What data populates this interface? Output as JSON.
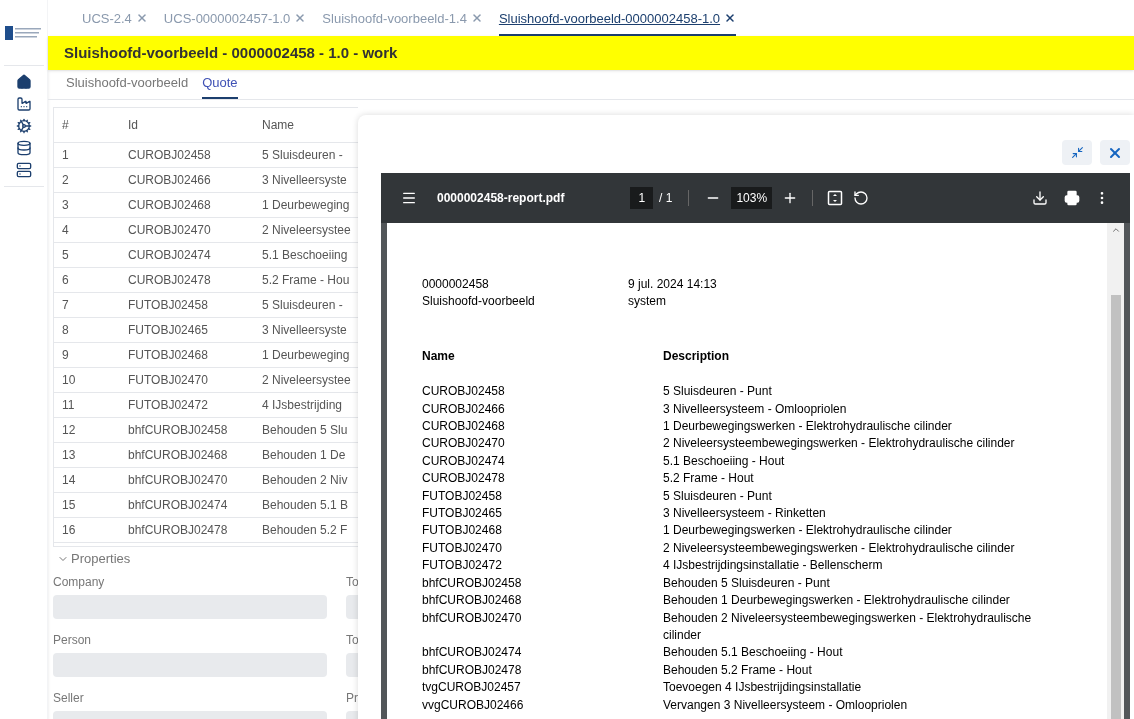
{
  "tabs": [
    {
      "label": "UCS-2.4",
      "selected": false
    },
    {
      "label": "UCS-0000002457-1.0",
      "selected": false
    },
    {
      "label": "Sluishoofd-voorbeeld-1.4",
      "selected": false
    },
    {
      "label": "Sluishoofd-voorbeeld-0000002458-1.0",
      "selected": true
    }
  ],
  "title": "Sluishoofd-voorbeeld - 0000002458 - 1.0 - work",
  "subtabs": [
    {
      "label": "Sluishoofd-voorbeeld",
      "selected": false
    },
    {
      "label": "Quote",
      "selected": true
    }
  ],
  "table": {
    "columns": [
      "#",
      "Id",
      "Name"
    ],
    "rows": [
      [
        "1",
        "CUROBJ02458",
        "5 Sluisdeuren -"
      ],
      [
        "2",
        "CUROBJ02466",
        "3 Nivelleersyste"
      ],
      [
        "3",
        "CUROBJ02468",
        "1 Deurbeweging"
      ],
      [
        "4",
        "CUROBJ02470",
        "2 Niveleersystee"
      ],
      [
        "5",
        "CUROBJ02474",
        "5.1 Beschoeiing"
      ],
      [
        "6",
        "CUROBJ02478",
        "5.2 Frame - Hou"
      ],
      [
        "7",
        "FUTOBJ02458",
        "5 Sluisdeuren -"
      ],
      [
        "8",
        "FUTOBJ02465",
        "3 Nivelleersyste"
      ],
      [
        "9",
        "FUTOBJ02468",
        "1 Deurbeweging"
      ],
      [
        "10",
        "FUTOBJ02470",
        "2 Niveleersystee"
      ],
      [
        "11",
        "FUTOBJ02472",
        "4 IJsbestrijding"
      ],
      [
        "12",
        "bhfCUROBJ02458",
        "Behouden 5 Slu"
      ],
      [
        "13",
        "bhfCUROBJ02468",
        "Behouden 1 De"
      ],
      [
        "14",
        "bhfCUROBJ02470",
        "Behouden 2 Niv"
      ],
      [
        "15",
        "bhfCUROBJ02474",
        "Behouden 5.1 B"
      ],
      [
        "16",
        "bhfCUROBJ02478",
        "Behouden 5.2 F"
      ]
    ]
  },
  "properties": {
    "title": "Properties",
    "expanded": true,
    "fields": [
      {
        "label": "Company",
        "side_label": "To"
      },
      {
        "label": "Person",
        "side_label": "To"
      },
      {
        "label": "Seller",
        "side_label": "Pr"
      }
    ]
  },
  "viewer": {
    "filename": "0000002458-report.pdf",
    "page": "1",
    "pages": "/ 1",
    "zoom": "103%",
    "meta": [
      [
        "0000002458",
        "9 jul. 2024 14:13"
      ],
      [
        "Sluishoofd-voorbeeld",
        "system"
      ]
    ],
    "columns": [
      "Name",
      "Description"
    ],
    "rows": [
      [
        "CUROBJ02458",
        "5 Sluisdeuren - Punt"
      ],
      [
        "CUROBJ02466",
        "3 Nivelleersysteem - Omloopriolen"
      ],
      [
        "CUROBJ02468",
        "1 Deurbewegingswerken - Elektrohydraulische cilinder"
      ],
      [
        "CUROBJ02470",
        "2 Niveleersysteembewegingswerken - Elektrohydraulische cilinder"
      ],
      [
        "CUROBJ02474",
        "5.1 Beschoeiing - Hout"
      ],
      [
        "CUROBJ02478",
        "5.2 Frame - Hout"
      ],
      [
        "FUTOBJ02458",
        "5 Sluisdeuren - Punt"
      ],
      [
        "FUTOBJ02465",
        "3 Nivelleersysteem - Rinketten"
      ],
      [
        "FUTOBJ02468",
        "1 Deurbewegingswerken - Elektrohydraulische cilinder"
      ],
      [
        "FUTOBJ02470",
        "2 Niveleersysteembewegingswerken - Elektrohydraulische cilinder"
      ],
      [
        "FUTOBJ02472",
        "4 IJsbestrijdingsinstallatie - Bellenscherm"
      ],
      [
        "bhfCUROBJ02458",
        "Behouden 5 Sluisdeuren - Punt"
      ],
      [
        "bhfCUROBJ02468",
        "Behouden 1 Deurbewegingswerken - Elektrohydraulische cilinder"
      ],
      [
        "bhfCUROBJ02470",
        "Behouden 2 Niveleersysteembewegingswerken - Elektrohydraulische cilinder"
      ],
      [
        "bhfCUROBJ02474",
        "Behouden 5.1 Beschoeiing - Hout"
      ],
      [
        "bhfCUROBJ02478",
        "Behouden 5.2 Frame - Hout"
      ],
      [
        "tvgCUROBJ02457",
        "Toevoegen 4 IJsbestrijdingsinstallatie"
      ],
      [
        "vvgCUROBJ02466",
        "Vervangen 3 Nivelleersysteem - Omloopriolen"
      ]
    ]
  }
}
